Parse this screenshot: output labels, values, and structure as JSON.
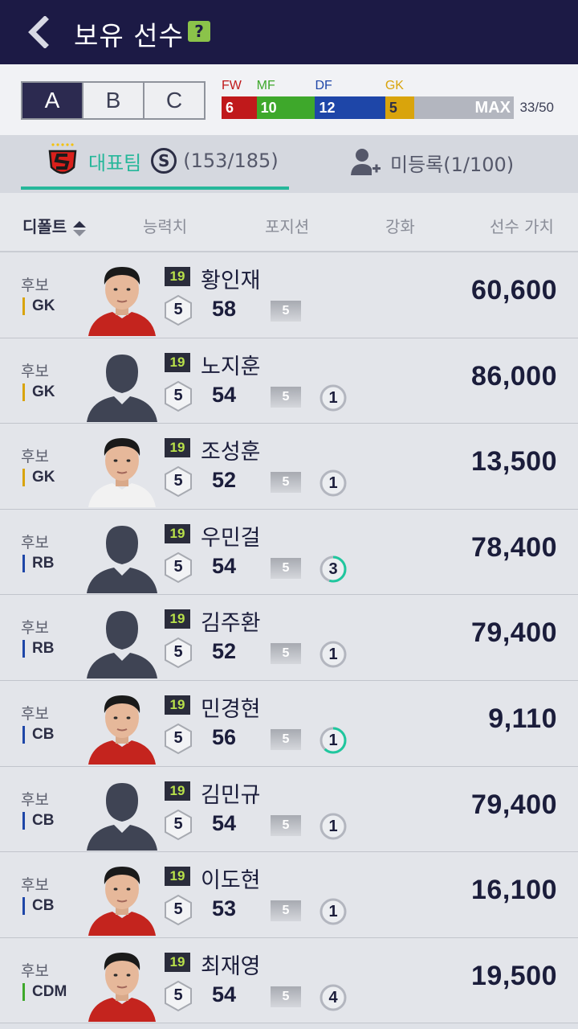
{
  "header": {
    "title": "보유 선수",
    "help_label": "?"
  },
  "squad_tabs": [
    "A",
    "B",
    "C"
  ],
  "position_summary": {
    "segments": [
      {
        "label": "FW",
        "count": "6",
        "color": "#c0191b",
        "label_color": "#c0191b"
      },
      {
        "label": "MF",
        "count": "10",
        "color": "#3ea82b",
        "label_color": "#3ea82b"
      },
      {
        "label": "DF",
        "count": "12",
        "color": "#1e46a8",
        "label_color": "#1e46a8"
      },
      {
        "label": "GK",
        "count": "5",
        "color": "#d9a40c",
        "label_color": "#d9a40c"
      }
    ],
    "max_label": "MAX",
    "total": "33/50"
  },
  "team_tabs": {
    "represent_label": "대표팀",
    "represent_count": "(153/185)",
    "unregistered_label": "미등록(1/100)"
  },
  "columns": {
    "default": "디폴트",
    "ability": "능력치",
    "position": "포지션",
    "enhance": "강화",
    "value": "선수 가치"
  },
  "players": [
    {
      "status": "후보",
      "position": "GK",
      "pos_color": "#d9a40c",
      "season": "19",
      "name": "황인재",
      "grade": "5",
      "ovr": "58",
      "sbadge": "5",
      "enhance": "",
      "enhance_progress": 0,
      "value": "60,600",
      "photo": "red"
    },
    {
      "status": "후보",
      "position": "GK",
      "pos_color": "#d9a40c",
      "season": "19",
      "name": "노지훈",
      "grade": "5",
      "ovr": "54",
      "sbadge": "5",
      "enhance": "1",
      "enhance_progress": 0,
      "value": "86,000",
      "photo": "silhouette"
    },
    {
      "status": "후보",
      "position": "GK",
      "pos_color": "#d9a40c",
      "season": "19",
      "name": "조성훈",
      "grade": "5",
      "ovr": "52",
      "sbadge": "5",
      "enhance": "1",
      "enhance_progress": 0,
      "value": "13,500",
      "photo": "white"
    },
    {
      "status": "후보",
      "position": "RB",
      "pos_color": "#1e46a8",
      "season": "19",
      "name": "우민걸",
      "grade": "5",
      "ovr": "54",
      "sbadge": "5",
      "enhance": "3",
      "enhance_progress": 0.55,
      "value": "78,400",
      "photo": "silhouette"
    },
    {
      "status": "후보",
      "position": "RB",
      "pos_color": "#1e46a8",
      "season": "19",
      "name": "김주환",
      "grade": "5",
      "ovr": "52",
      "sbadge": "5",
      "enhance": "1",
      "enhance_progress": 0,
      "value": "79,400",
      "photo": "silhouette"
    },
    {
      "status": "후보",
      "position": "CB",
      "pos_color": "#1e46a8",
      "season": "19",
      "name": "민경현",
      "grade": "5",
      "ovr": "56",
      "sbadge": "5",
      "enhance": "1",
      "enhance_progress": 0.62,
      "value": "9,110",
      "photo": "red"
    },
    {
      "status": "후보",
      "position": "CB",
      "pos_color": "#1e46a8",
      "season": "19",
      "name": "김민규",
      "grade": "5",
      "ovr": "54",
      "sbadge": "5",
      "enhance": "1",
      "enhance_progress": 0,
      "value": "79,400",
      "photo": "silhouette"
    },
    {
      "status": "후보",
      "position": "CB",
      "pos_color": "#1e46a8",
      "season": "19",
      "name": "이도현",
      "grade": "5",
      "ovr": "53",
      "sbadge": "5",
      "enhance": "1",
      "enhance_progress": 0,
      "value": "16,100",
      "photo": "red"
    },
    {
      "status": "후보",
      "position": "CDM",
      "pos_color": "#3ea82b",
      "season": "19",
      "name": "최재영",
      "grade": "5",
      "ovr": "54",
      "sbadge": "5",
      "enhance": "4",
      "enhance_progress": 0,
      "value": "19,500",
      "photo": "red"
    }
  ]
}
